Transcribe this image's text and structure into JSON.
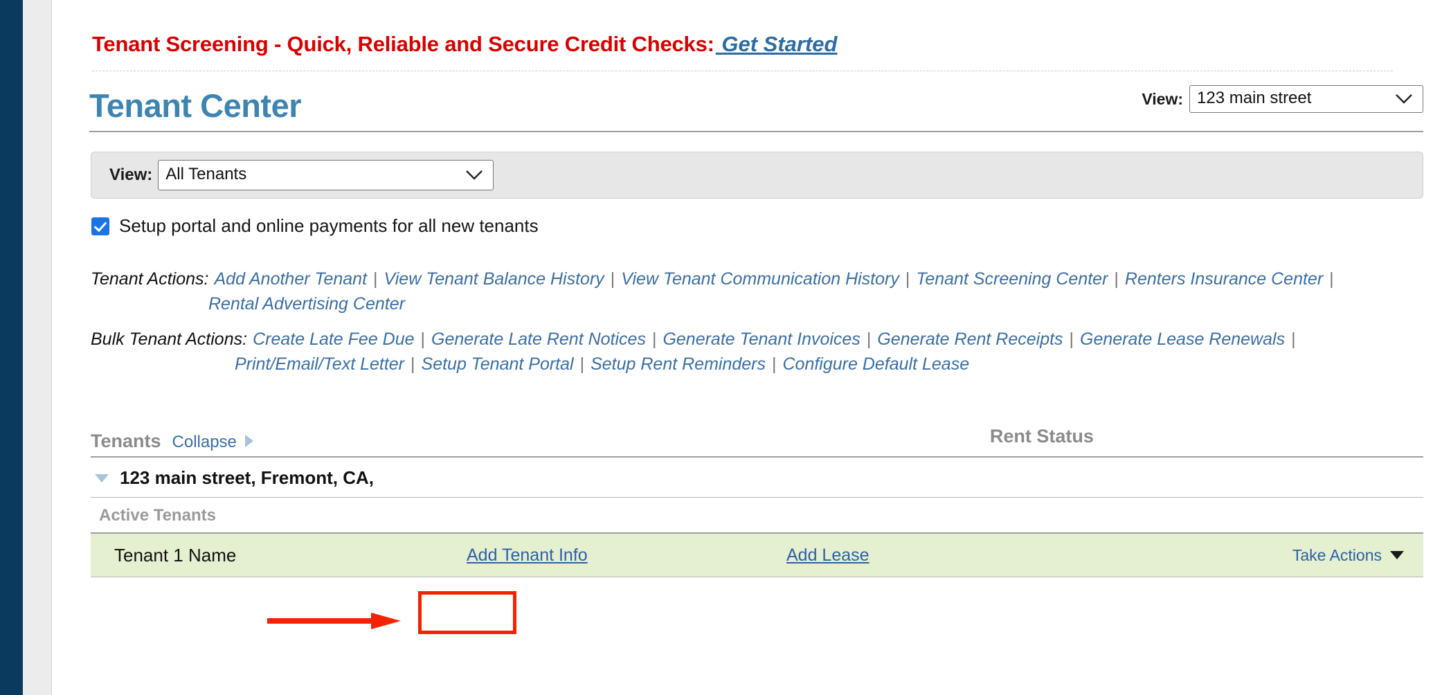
{
  "promo": {
    "text": "Tenant Screening - Quick, Reliable and Secure Credit Checks:",
    "link": " Get Started"
  },
  "header": {
    "title": "Tenant Center",
    "view_label": "View:",
    "view_value": "123 main street"
  },
  "view_panel": {
    "label": "View:",
    "value": "All Tenants"
  },
  "setup_checkbox": {
    "label": "Setup portal and online payments for all new tenants",
    "checked": true
  },
  "tenant_actions": {
    "caption": "Tenant Actions:",
    "links": [
      "Add Another Tenant",
      "View Tenant Balance History",
      "View Tenant Communication History",
      "Tenant Screening Center",
      "Renters Insurance Center"
    ],
    "links_line2": [
      "Rental Advertising Center"
    ]
  },
  "bulk_tenant_actions": {
    "caption": "Bulk Tenant Actions:",
    "links": [
      "Create Late Fee Due",
      "Generate Late Rent Notices",
      "Generate Tenant Invoices",
      "Generate Rent Receipts",
      "Generate Lease Renewals"
    ],
    "links_line2": [
      "Print/Email/Text Letter",
      "Setup Tenant Portal",
      "Setup Rent Reminders",
      "Configure Default Lease"
    ]
  },
  "table": {
    "header_tenants": "Tenants",
    "header_collapse": "Collapse",
    "header_rent_status": "Rent Status",
    "property_address": "123 main street, Fremont, CA,",
    "section_label": "Active Tenants",
    "rows": [
      {
        "name": "Tenant 1 Name",
        "info_link": "Add Tenant Info",
        "lease_link": "Add Lease",
        "actions_label": "Take Actions"
      }
    ]
  },
  "colors": {
    "promo_red": "#d90000",
    "title_blue": "#3d85b0",
    "link_blue": "#3a6ea5",
    "row_green": "#e4f0cf",
    "annotation_red": "#f42200",
    "rail_navy": "#0a3a5e"
  }
}
